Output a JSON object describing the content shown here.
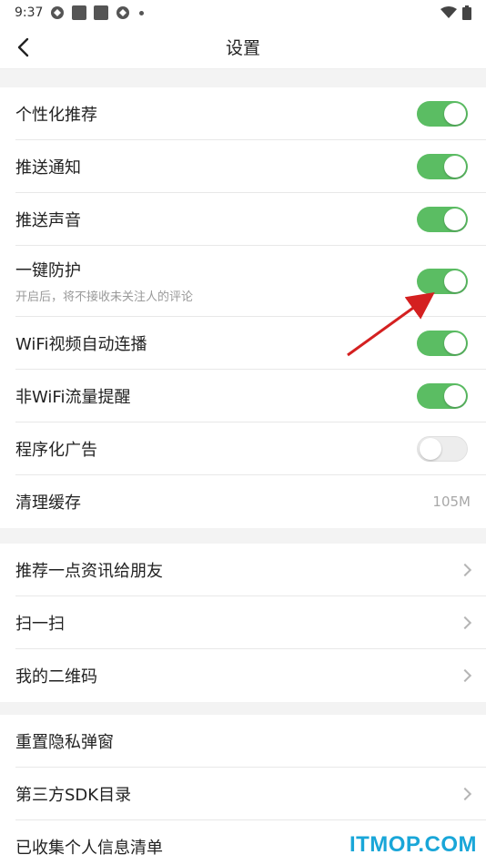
{
  "status_bar": {
    "time": "9:37"
  },
  "app_bar": {
    "title": "设置"
  },
  "toggles_section": [
    {
      "label": "个性化推荐",
      "on": true
    },
    {
      "label": "推送通知",
      "on": true
    },
    {
      "label": "推送声音",
      "on": true
    },
    {
      "label": "一键防护",
      "sub": "开启后，将不接收未关注人的评论",
      "on": true
    },
    {
      "label": "WiFi视频自动连播",
      "on": true
    },
    {
      "label": "非WiFi流量提醒",
      "on": true
    },
    {
      "label": "程序化广告",
      "on": false
    },
    {
      "label": "清理缓存",
      "value": "105M"
    }
  ],
  "share_section": [
    {
      "label": "推荐一点资讯给朋友"
    },
    {
      "label": "扫一扫"
    },
    {
      "label": "我的二维码"
    }
  ],
  "privacy_section": [
    {
      "label": "重置隐私弹窗"
    },
    {
      "label": "第三方SDK目录"
    },
    {
      "label": "已收集个人信息清单"
    }
  ],
  "watermark": "ITMOP.COM",
  "colors": {
    "toggle_on": "#5bbd63",
    "arrow": "#d42020",
    "watermark": "#19a6d8"
  }
}
